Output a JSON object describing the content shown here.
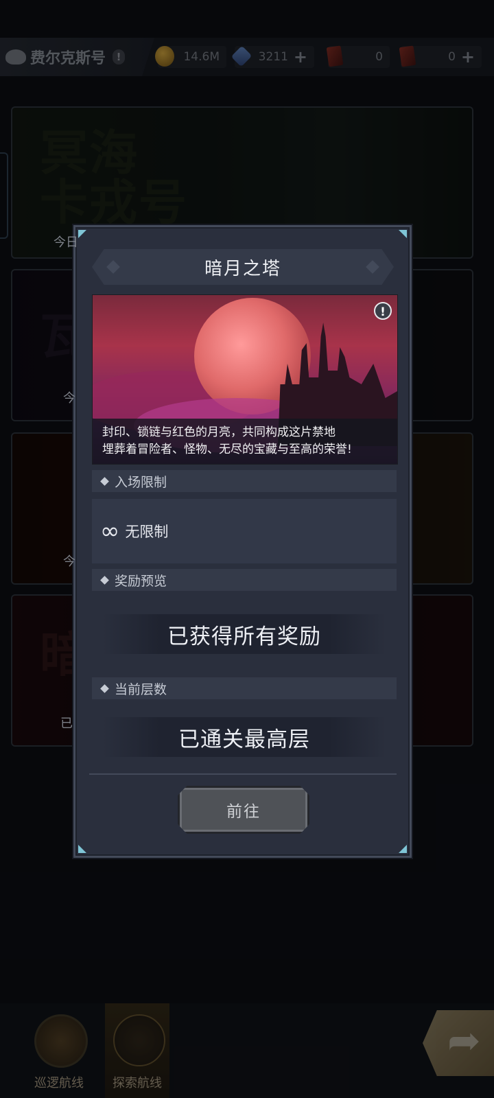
{
  "topbar": {
    "ship_name": "费尔克斯号",
    "alert_glyph": "!",
    "gold": "14.6M",
    "crystals": "3211",
    "ticket_a": "0",
    "ticket_b": "0",
    "plus": "+"
  },
  "background_cards": [
    {
      "title": "冥海\n卡戎号",
      "subtitle": "今日"
    },
    {
      "title": "瓦",
      "subtitle": "今"
    },
    {
      "title": "",
      "subtitle": "今"
    },
    {
      "title": "暗",
      "subtitle": "已"
    }
  ],
  "modal": {
    "title": "暗月之塔",
    "info_glyph": "!",
    "description_line1": "封印、锁链与红色的月亮，共同构成这片禁地",
    "description_line2": "埋葬着冒险者、怪物、无尽的宝藏与至高的荣誉!",
    "entry_header": "入场限制",
    "infinity_glyph": "∞",
    "entry_value": "无限制",
    "reward_header": "奖励预览",
    "reward_status": "已获得所有奖励",
    "floor_header": "当前层数",
    "floor_status": "已通关最高层",
    "go_button": "前往"
  },
  "bottom_nav": {
    "patrol_label": "巡逻航线",
    "explore_label": "探索航线",
    "arrow_glyph": "➦"
  },
  "colors": {
    "modal_bg": "#2a2f3d",
    "section_bg": "#343a49",
    "corner_accent": "#7fc5d6",
    "button_bg": "#4f5257"
  }
}
